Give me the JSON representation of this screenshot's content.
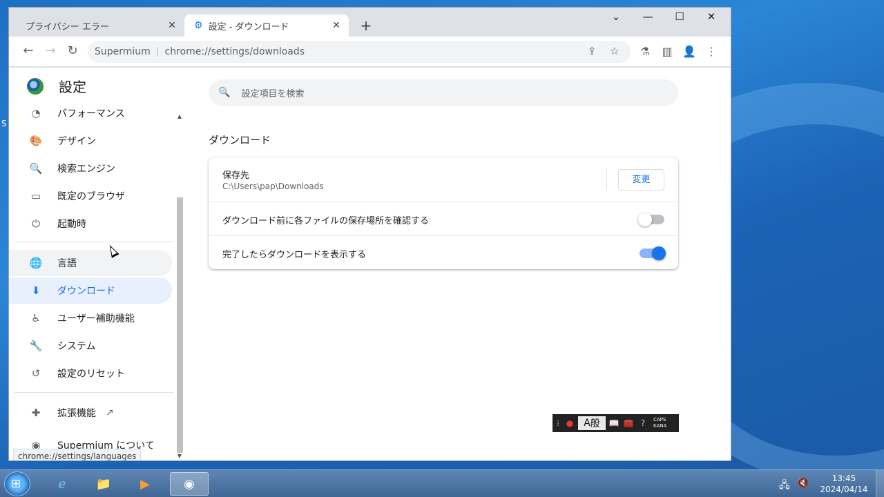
{
  "desktop": {
    "edge_letter": "S"
  },
  "tabs": [
    {
      "label": "プライバシー エラー",
      "close": "✕"
    },
    {
      "label": "設定 - ダウンロード",
      "close": "✕",
      "icon": "gear-icon"
    }
  ],
  "new_tab": "+",
  "window_controls": {
    "tab_search": "⌄",
    "minimize": "—",
    "maximize": "☐",
    "close": "✕"
  },
  "omnibox": {
    "site": "Supermium",
    "url": "chrome://settings/downloads"
  },
  "toolbar_icons": {
    "back": "←",
    "forward": "→",
    "reload": "↻",
    "share": "⇪",
    "bookmark": "☆",
    "labs": "⚗",
    "sidepanel": "▥",
    "profile": "👤",
    "menu": "⋮"
  },
  "sidebar": {
    "title": "設定",
    "items": [
      {
        "label": "パフォーマンス",
        "icon": "speedometer-icon",
        "glyph": "◔"
      },
      {
        "label": "デザイン",
        "icon": "palette-icon",
        "glyph": "🎨"
      },
      {
        "label": "検索エンジン",
        "icon": "search-icon",
        "glyph": "🔍"
      },
      {
        "label": "既定のブラウザ",
        "icon": "browser-icon",
        "glyph": "▭"
      },
      {
        "label": "起動時",
        "icon": "power-icon",
        "glyph": "⏻"
      },
      {
        "label": "言語",
        "icon": "globe-icon",
        "glyph": "🌐"
      },
      {
        "label": "ダウンロード",
        "icon": "download-icon",
        "glyph": "⬇"
      },
      {
        "label": "ユーザー補助機能",
        "icon": "accessibility-icon",
        "glyph": "♿"
      },
      {
        "label": "システム",
        "icon": "wrench-icon",
        "glyph": "🔧"
      },
      {
        "label": "設定のリセット",
        "icon": "history-icon",
        "glyph": "↺"
      },
      {
        "label": "拡張機能",
        "icon": "puzzle-icon",
        "glyph": "✚",
        "external": "↗"
      },
      {
        "label": "Supermium について",
        "icon": "supermium-logo-icon",
        "glyph": "◉"
      }
    ]
  },
  "status_tip": "chrome://settings/languages",
  "search": {
    "placeholder": "設定項目を検索"
  },
  "section": {
    "title": "ダウンロード"
  },
  "downloads": {
    "location_label": "保存先",
    "location_path": "C:\\Users\\pap\\Downloads",
    "change_button": "変更",
    "ask_label": "ダウンロード前に各ファイルの保存場所を確認する",
    "ask_enabled": false,
    "show_label": "完了したらダウンロードを表示する",
    "show_enabled": true
  },
  "ime": {
    "mode": "A",
    "kanji": "般",
    "help": "?",
    "caps": "CAPS",
    "kana": "KANA"
  },
  "taskbar": {
    "start": "⊞",
    "clock_time": "13:45",
    "clock_date": "2024/04/14"
  },
  "colors": {
    "accent": "#1a73e8",
    "selected_bg": "#e8f0fe"
  }
}
